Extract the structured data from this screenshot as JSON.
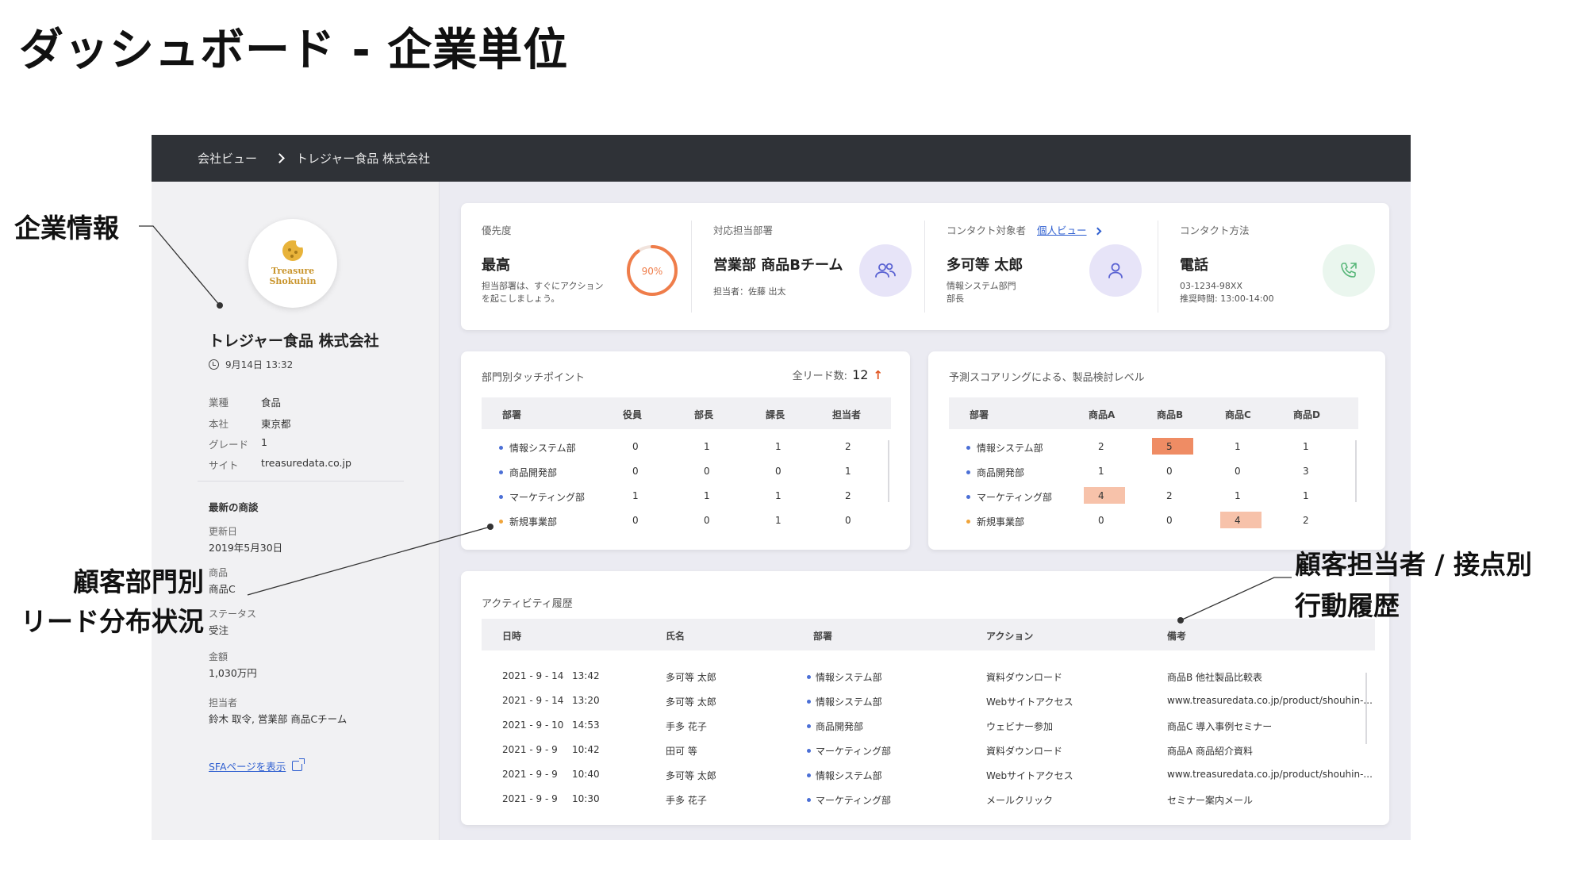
{
  "page_title": "ダッシュボード - 企業単位",
  "breadcrumb": {
    "root": "会社ビュー",
    "current": "トレジャー食品 株式会社"
  },
  "company": {
    "logo_line1": "Treasure",
    "logo_line2": "Shokuhin",
    "name": "トレジャー食品 株式会社",
    "updated": "9月14日 13:32",
    "info": [
      {
        "key": "業種",
        "value": "食品"
      },
      {
        "key": "本社",
        "value": "東京都"
      },
      {
        "key": "グレード",
        "value": "1"
      },
      {
        "key": "サイト",
        "value": "treasuredata.co.jp"
      }
    ],
    "latest_deal_title": "最新の商談",
    "deal_fields": [
      {
        "key": "更新日",
        "value": "2019年5月30日"
      },
      {
        "key": "商品",
        "value": "商品C"
      },
      {
        "key": "ステータス",
        "value": "受注"
      },
      {
        "key": "金額",
        "value": "1,030万円"
      },
      {
        "key": "担当者",
        "value": "鈴木 取令, 営業部 商品Cチーム"
      }
    ],
    "sfa_link": "SFAページを表示"
  },
  "kpis": {
    "priority": {
      "label": "優先度",
      "value": "最高",
      "sub1": "担当部署は、すぐにアクション",
      "sub2": "を起こしましょう。",
      "percent_text": "90%",
      "percent": 90
    },
    "department": {
      "label": "対応担当部署",
      "value": "営業部 商品Bチーム",
      "sub1": "担当者：佐藤 出太"
    },
    "contact_target": {
      "label": "コンタクト対象者",
      "link": "個人ビュー",
      "value": "多可等 太郎",
      "sub1": "情報システム部門",
      "sub2": "部長"
    },
    "contact_method": {
      "label": "コンタクト方法",
      "value": "電話",
      "sub1": "03-1234-98XX",
      "sub2": "推奨時間: 13:00-14:00"
    }
  },
  "touchpoints": {
    "title": "部門別タッチポイント",
    "lead_label": "全リード数:",
    "lead_count": "12",
    "headers": [
      "部署",
      "役員",
      "部長",
      "課長",
      "担当者"
    ],
    "rows": [
      {
        "dept": "情報システム部",
        "dot_color": "#4b6fd6",
        "cells": [
          "0",
          "1",
          "1",
          "2"
        ]
      },
      {
        "dept": "商品開発部",
        "dot_color": "#4b6fd6",
        "cells": [
          "0",
          "0",
          "0",
          "1"
        ]
      },
      {
        "dept": "マーケティング部",
        "dot_color": "#4b6fd6",
        "cells": [
          "1",
          "1",
          "1",
          "2"
        ]
      },
      {
        "dept": "新規事業部",
        "dot_color": "#f0a43a",
        "cells": [
          "0",
          "0",
          "1",
          "0"
        ]
      }
    ]
  },
  "scoring": {
    "title": "予測スコアリングによる、製品検討レベル",
    "headers": [
      "部署",
      "商品A",
      "商品B",
      "商品C",
      "商品D"
    ],
    "rows": [
      {
        "dept": "情報システム部",
        "dot_color": "#4b6fd6",
        "cells": [
          "2",
          "5",
          "1",
          "1"
        ]
      },
      {
        "dept": "商品開発部",
        "dot_color": "#4b6fd6",
        "cells": [
          "1",
          "0",
          "0",
          "3"
        ]
      },
      {
        "dept": "マーケティング部",
        "dot_color": "#4b6fd6",
        "cells": [
          "4",
          "2",
          "1",
          "1"
        ]
      },
      {
        "dept": "新規事業部",
        "dot_color": "#f0a43a",
        "cells": [
          "0",
          "0",
          "4",
          "2"
        ]
      }
    ],
    "highlight_strong": "#ef8c64",
    "highlight_light": "#f7c2aa"
  },
  "activity": {
    "title": "アクティビティ履歴",
    "headers": [
      "日時",
      "氏名",
      "部署",
      "アクション",
      "備考"
    ],
    "rows": [
      {
        "date": "2021 - 9 - 14",
        "time": "13:42",
        "name": "多可等 太郎",
        "dept": "情報システム部",
        "action": "資料ダウンロード",
        "note": "商品B 他社製品比較表"
      },
      {
        "date": "2021 - 9 - 14",
        "time": "13:20",
        "name": "多可等 太郎",
        "dept": "情報システム部",
        "action": "Webサイトアクセス",
        "note": "www.treasuredata.co.jp/product/shouhin-..."
      },
      {
        "date": "2021 - 9 - 10",
        "time": "14:53",
        "name": "手多 花子",
        "dept": "商品開発部",
        "action": "ウェビナー参加",
        "note": "商品C 導入事例セミナー"
      },
      {
        "date": "2021 - 9 - 9",
        "time": "10:42",
        "name": "田可 等",
        "dept": "マーケティング部",
        "action": "資料ダウンロード",
        "note": "商品A 商品紹介資料"
      },
      {
        "date": "2021 - 9 - 9",
        "time": "10:40",
        "name": "多可等 太郎",
        "dept": "情報システム部",
        "action": "Webサイトアクセス",
        "note": "www.treasuredata.co.jp/product/shouhin-..."
      },
      {
        "date": "2021 - 9 - 9",
        "time": "10:30",
        "name": "手多 花子",
        "dept": "マーケティング部",
        "action": "メールクリック",
        "note": "セミナー案内メール"
      }
    ]
  },
  "callouts": {
    "company_info": "企業情報",
    "lead_dist_line1": "顧客部門別",
    "lead_dist_line2": "リード分布状況",
    "history_line1": "顧客担当者 / 接点別",
    "history_line2": "行動履歴"
  },
  "colors": {
    "accent_blue": "#2f5fd0",
    "ring_orange": "#ef7d4a",
    "purple_icon_bg": "#e7e4f8",
    "green_icon_bg": "#eaf6ee"
  },
  "icons": [
    "cookie-logo-icon",
    "clock-icon",
    "external-link-icon",
    "team-icon",
    "person-icon",
    "phone-icon",
    "chevron-right-icon",
    "up-arrow-icon"
  ]
}
